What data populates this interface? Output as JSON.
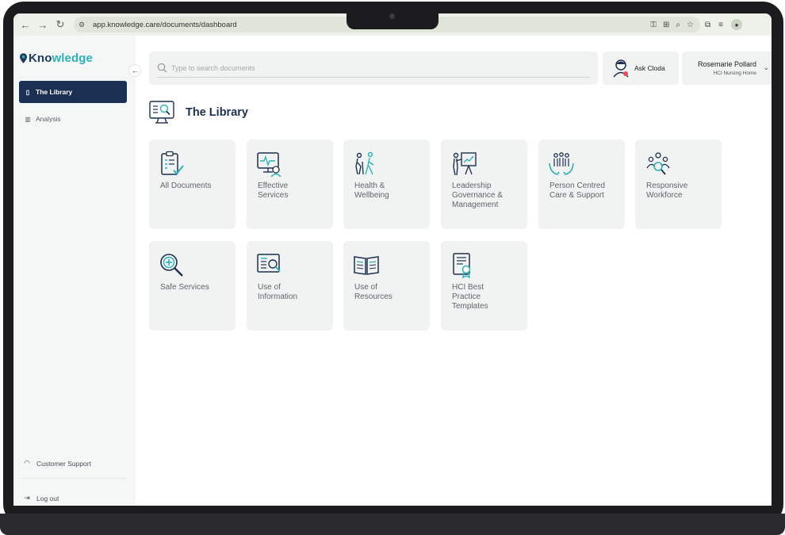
{
  "browser": {
    "url": "app.knowledge.care/documents/dashboard"
  },
  "brand": {
    "logo_text": "Knowledge",
    "accent": "#2bb3b6",
    "primary": "#1b2f52"
  },
  "sidebar": {
    "items": [
      {
        "label": "The Library",
        "icon": "book-icon",
        "active": true
      },
      {
        "label": "Analysis",
        "icon": "bar-chart-icon",
        "active": false
      }
    ],
    "bottom": [
      {
        "label": "Customer Support",
        "icon": "headphones-icon"
      },
      {
        "label": "Log out",
        "icon": "logout-icon"
      }
    ]
  },
  "search": {
    "placeholder": "Type to search documents"
  },
  "assistant": {
    "label": "Ask Cloda"
  },
  "user": {
    "name": "Rosemarie Pollard",
    "org": "HCI Nursing Home"
  },
  "page": {
    "title": "The Library"
  },
  "categories": [
    {
      "label": "All Documents",
      "icon": "clipboard-check-icon"
    },
    {
      "label": "Effective\nServices",
      "icon": "monitor-heartbeat-icon"
    },
    {
      "label": "Health &\nWellbeing",
      "icon": "elderly-walking-icon"
    },
    {
      "label": "Leadership\nGovernance &\nManagement",
      "icon": "presenter-board-icon"
    },
    {
      "label": "Person Centred\nCare & Support",
      "icon": "people-care-icon"
    },
    {
      "label": "Responsive\nWorkforce",
      "icon": "team-search-icon"
    },
    {
      "label": "Safe Services",
      "icon": "magnifier-plus-icon"
    },
    {
      "label": "Use of\nInformation",
      "icon": "document-search-icon"
    },
    {
      "label": "Use of\nResources",
      "icon": "open-book-icon"
    },
    {
      "label": "HCI Best\nPractice\nTemplates",
      "icon": "certificate-icon"
    }
  ]
}
